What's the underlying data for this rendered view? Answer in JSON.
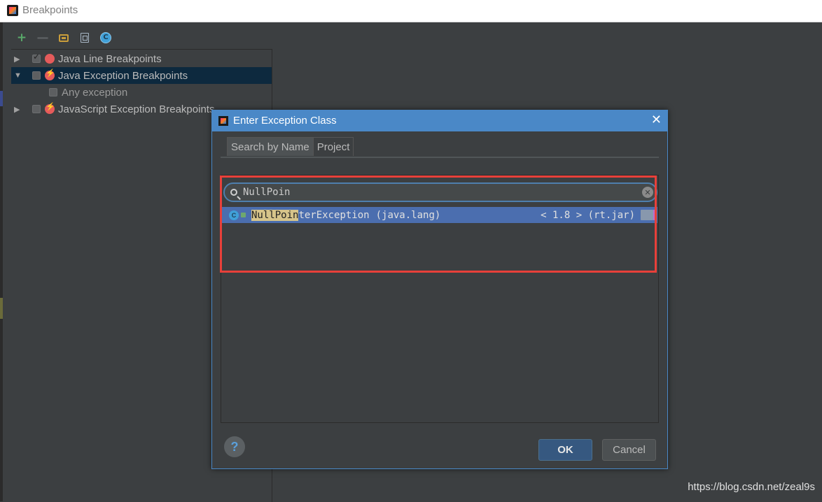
{
  "window": {
    "title": "Breakpoints"
  },
  "toolbar": {
    "add_label": "+",
    "remove_label": "—",
    "class_label": "C"
  },
  "tree": {
    "items": [
      {
        "label": "Java Line Breakpoints",
        "toggle": "▶",
        "checked": true
      },
      {
        "label": "Java Exception Breakpoints",
        "toggle": "▼",
        "checked": false,
        "selected": true
      },
      {
        "label": "Any exception",
        "child": true
      },
      {
        "label": "JavaScript Exception Breakpoints",
        "toggle": "▶",
        "checked": false
      }
    ]
  },
  "dialog": {
    "title": "Enter Exception Class",
    "close_label": "✕",
    "tabs": [
      {
        "label": "Search by Name",
        "active": true
      },
      {
        "label": "Project",
        "active": false
      }
    ],
    "search": {
      "value": "NullPoin",
      "clear_label": "✕"
    },
    "result": {
      "class_icon_label": "C",
      "match": "NullPoin",
      "rest": "terException",
      "package": "(java.lang)",
      "version": "< 1.8 > (rt.jar)"
    },
    "help_label": "?",
    "ok_label": "OK",
    "cancel_label": "Cancel"
  },
  "watermark": "https://blog.csdn.net/zeal9s",
  "colors": {
    "accent": "#4a88c7",
    "selection": "#4b6eaf",
    "highlight_border": "#e8403a",
    "match_bg": "#d6c48a"
  }
}
